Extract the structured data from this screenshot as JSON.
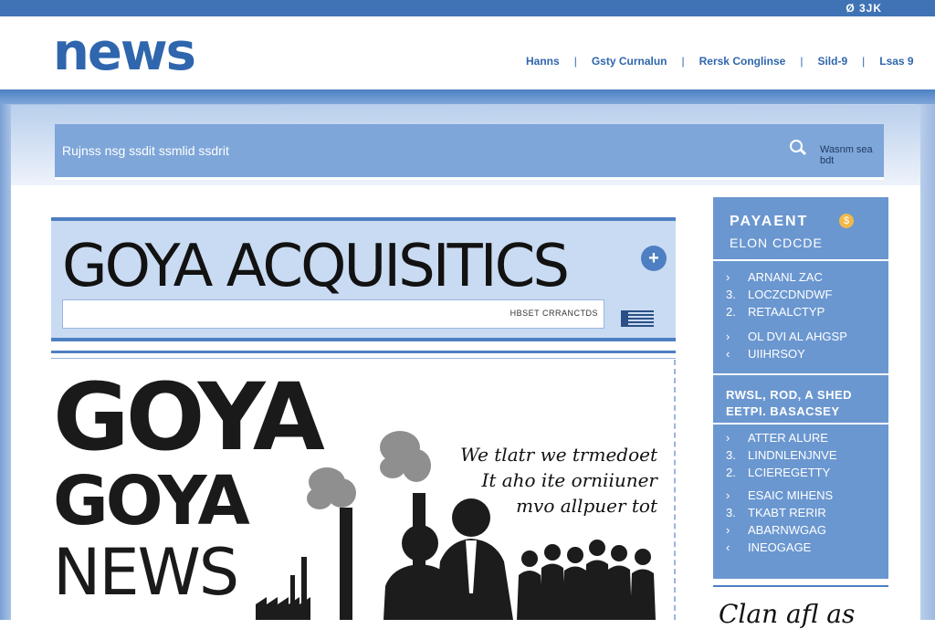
{
  "topbar": {
    "utility_text": "Ø 3JK"
  },
  "header": {
    "logo": "news",
    "nav": [
      "Hanns",
      "Gsty Curnalun",
      "Rersk Conglinse",
      "Sild-9",
      "Lsas 9"
    ]
  },
  "search": {
    "placeholder": "Rujnss nsg ssdit ssmlid ssdrit",
    "button_label": "Wasnm sea bdt"
  },
  "headline": {
    "title": "GOYA ACQUISITICS",
    "meta": "HBSET CRRANCTDS"
  },
  "article": {
    "big_line1": "GOYA",
    "big_line2": "GOYA",
    "big_line3": "NEWS",
    "quote_lines": [
      "We tlatr we trmedoet",
      "It aho ite orniiuner",
      "mvo allpuer tot"
    ]
  },
  "sidebar": {
    "title": "PAYAENT",
    "subtitle": "ELON CDCDE",
    "list1": [
      {
        "n": "›",
        "text": "ARNANL ZAC"
      },
      {
        "n": "3.",
        "text": "LOCZCDNDWF"
      },
      {
        "n": "2.",
        "text": "RETAALCTYP"
      },
      {
        "n": "›",
        "text": "OL DVI AL AHGSP"
      },
      {
        "n": "‹",
        "text": "UIIHRSOY"
      }
    ],
    "mid_lines": [
      "RWSL, ROD, A SHED",
      "EETPI. BASACSEY"
    ],
    "list2": [
      {
        "n": "›",
        "text": "ATTER ALURE"
      },
      {
        "n": "3.",
        "text": "LINDNLENJNVE"
      },
      {
        "n": "2.",
        "text": "LCIEREGETTY"
      },
      {
        "n": "›",
        "text": "ESAIC MIHENS"
      },
      {
        "n": "3.",
        "text": "TKABT RERIR"
      },
      {
        "n": "›",
        "text": "ABARNWGAG"
      },
      {
        "n": "‹",
        "text": "INEOGAGE"
      }
    ],
    "below_text": "Clan afl as"
  },
  "colors": {
    "brand": "#2f66ad",
    "panel": "#6b97d0",
    "accent": "#4d7fc2"
  }
}
